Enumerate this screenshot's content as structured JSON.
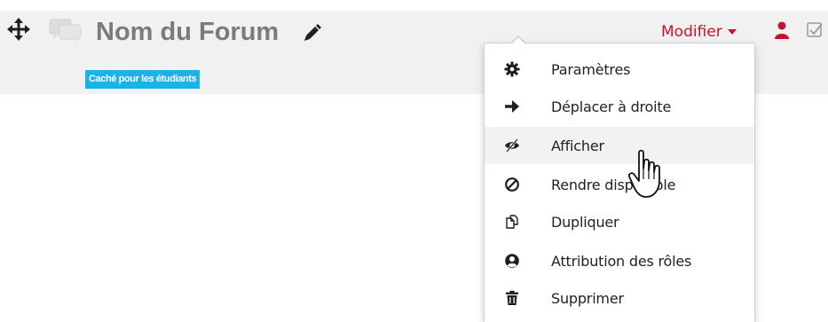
{
  "activity": {
    "title": "Nom du Forum",
    "visibility_badge": "Caché pour les étudiants"
  },
  "edit_menu": {
    "toggle_label": "Modifier",
    "items": [
      {
        "label": "Paramètres",
        "icon": "gear-icon"
      },
      {
        "label": "Déplacer à droite",
        "icon": "arrow-right-icon"
      },
      {
        "label": "Afficher",
        "icon": "eye-slash-icon"
      },
      {
        "label": "Rendre disponible",
        "icon": "ban-icon"
      },
      {
        "label": "Dupliquer",
        "icon": "copy-icon"
      },
      {
        "label": "Attribution des rôles",
        "icon": "user-circle-icon"
      },
      {
        "label": "Supprimer",
        "icon": "trash-icon"
      }
    ],
    "hovered_item": "Afficher"
  },
  "colors": {
    "accent_red": "#c8122b",
    "badge_blue": "#1ab3e8",
    "band_grey": "#f1f1f1",
    "title_grey": "#7b7b7b"
  }
}
